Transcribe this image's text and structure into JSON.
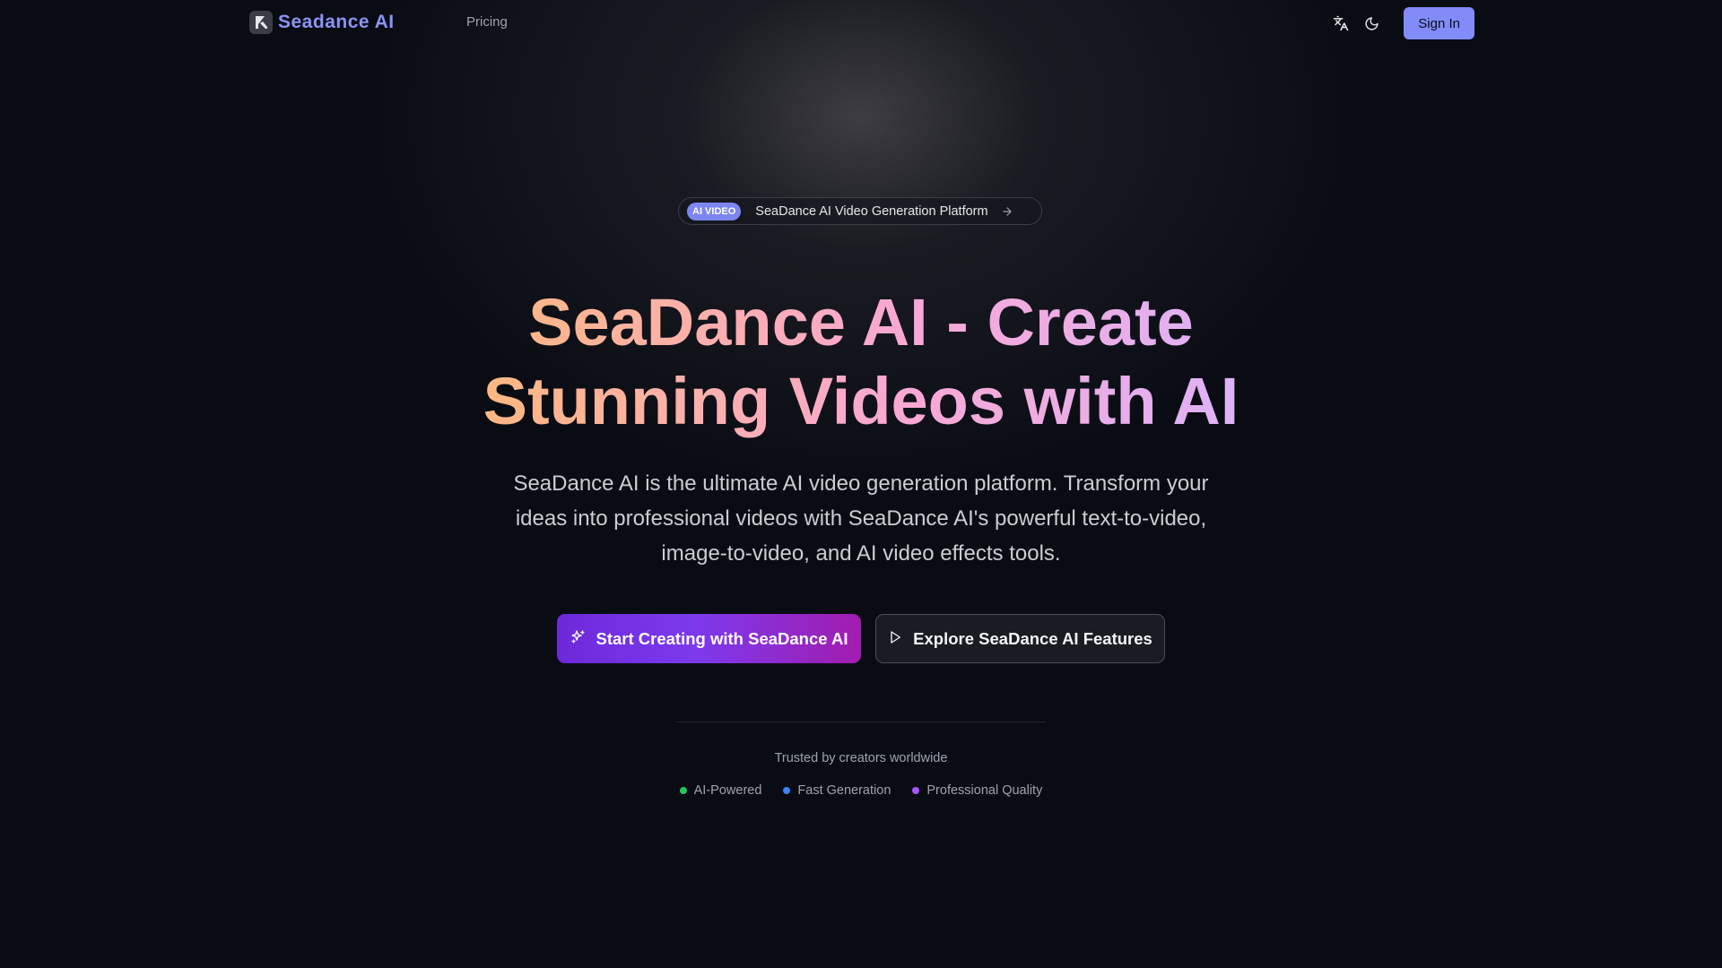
{
  "nav": {
    "brand": "Seadance AI",
    "links": [
      {
        "label": "Pricing"
      }
    ],
    "translate_icon": "translate-icon",
    "theme_icon": "moon-icon",
    "signin_label": "Sign In"
  },
  "colors": {
    "accent": "#818cf8",
    "brand_text": "#8b93f5",
    "cta_gradient": [
      "#6d28d9",
      "#a21caf"
    ],
    "headline_gradient": [
      "#fdba74",
      "#f9a8d4",
      "#d8b4fe"
    ]
  },
  "hero": {
    "badge_pill": "AI VIDEO",
    "badge_text": "SeaDance AI Video Generation Platform",
    "title_line1": "SeaDance AI - Create",
    "title_line2": "Stunning Videos with AI",
    "subtitle": "SeaDance AI is the ultimate AI video generation platform. Transform your ideas into professional videos with SeaDance AI's powerful text-to-video, image-to-video, and AI video effects tools.",
    "primary_cta": "Start Creating with SeaDance AI",
    "secondary_cta": "Explore SeaDance AI Features"
  },
  "trust": {
    "label": "Trusted by creators worldwide",
    "items": [
      {
        "label": "AI-Powered",
        "color": "#22c55e"
      },
      {
        "label": "Fast Generation",
        "color": "#3b82f6"
      },
      {
        "label": "Professional Quality",
        "color": "#a855f7"
      }
    ]
  }
}
